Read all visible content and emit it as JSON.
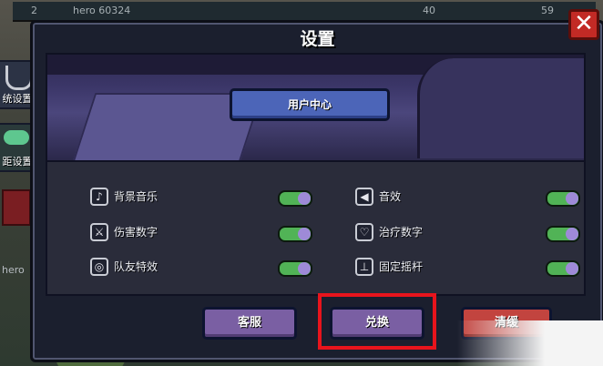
{
  "top_bar": {
    "level": "2",
    "name": "hero 60324",
    "coin_left": "40",
    "coin_right": "59"
  },
  "sidebar": {
    "tab_system": "统设置",
    "tab_controls": "距设置",
    "hero_label": "hero"
  },
  "dialog": {
    "title": "设置",
    "close_symbol": "✕",
    "user_center_label": "用户中心"
  },
  "settings": {
    "left": [
      {
        "label": "背景音乐",
        "icon": "music-icon",
        "enabled": true
      },
      {
        "label": "伤害数字",
        "icon": "damage-icon",
        "enabled": true
      },
      {
        "label": "队友特效",
        "icon": "teammate-effect-icon",
        "enabled": true
      }
    ],
    "right": [
      {
        "label": "音效",
        "icon": "sound-icon",
        "enabled": true
      },
      {
        "label": "治疗数字",
        "icon": "heart-icon",
        "enabled": true
      },
      {
        "label": "固定摇杆",
        "icon": "joystick-icon",
        "enabled": true
      }
    ]
  },
  "buttons": {
    "service": "客服",
    "redeem": "兑换",
    "clear": "清缓"
  },
  "colors": {
    "toggle_on": "#51b356",
    "highlight_border": "#e8141c",
    "close_red": "#c22a25"
  }
}
